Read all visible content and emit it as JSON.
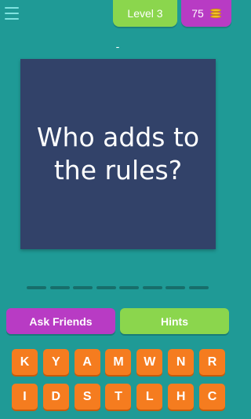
{
  "header": {
    "level_label": "Level 3",
    "coins": "75",
    "menu_icon": "menu-icon",
    "coin_icon": "coin-stack-icon"
  },
  "hint_reveal": "-",
  "question": "Who adds to the rules?",
  "answer_slot_count": 8,
  "buttons": {
    "ask_friends": "Ask Friends",
    "hints": "Hints"
  },
  "letters": {
    "row1": [
      "K",
      "Y",
      "A",
      "M",
      "W",
      "N",
      "R"
    ],
    "row2": [
      "I",
      "D",
      "S",
      "T",
      "L",
      "H",
      "C"
    ]
  },
  "colors": {
    "background": "#1f9a96",
    "card": "#324269",
    "green": "#8bd64d",
    "purple": "#b83bc4",
    "orange": "#f57c1f"
  }
}
